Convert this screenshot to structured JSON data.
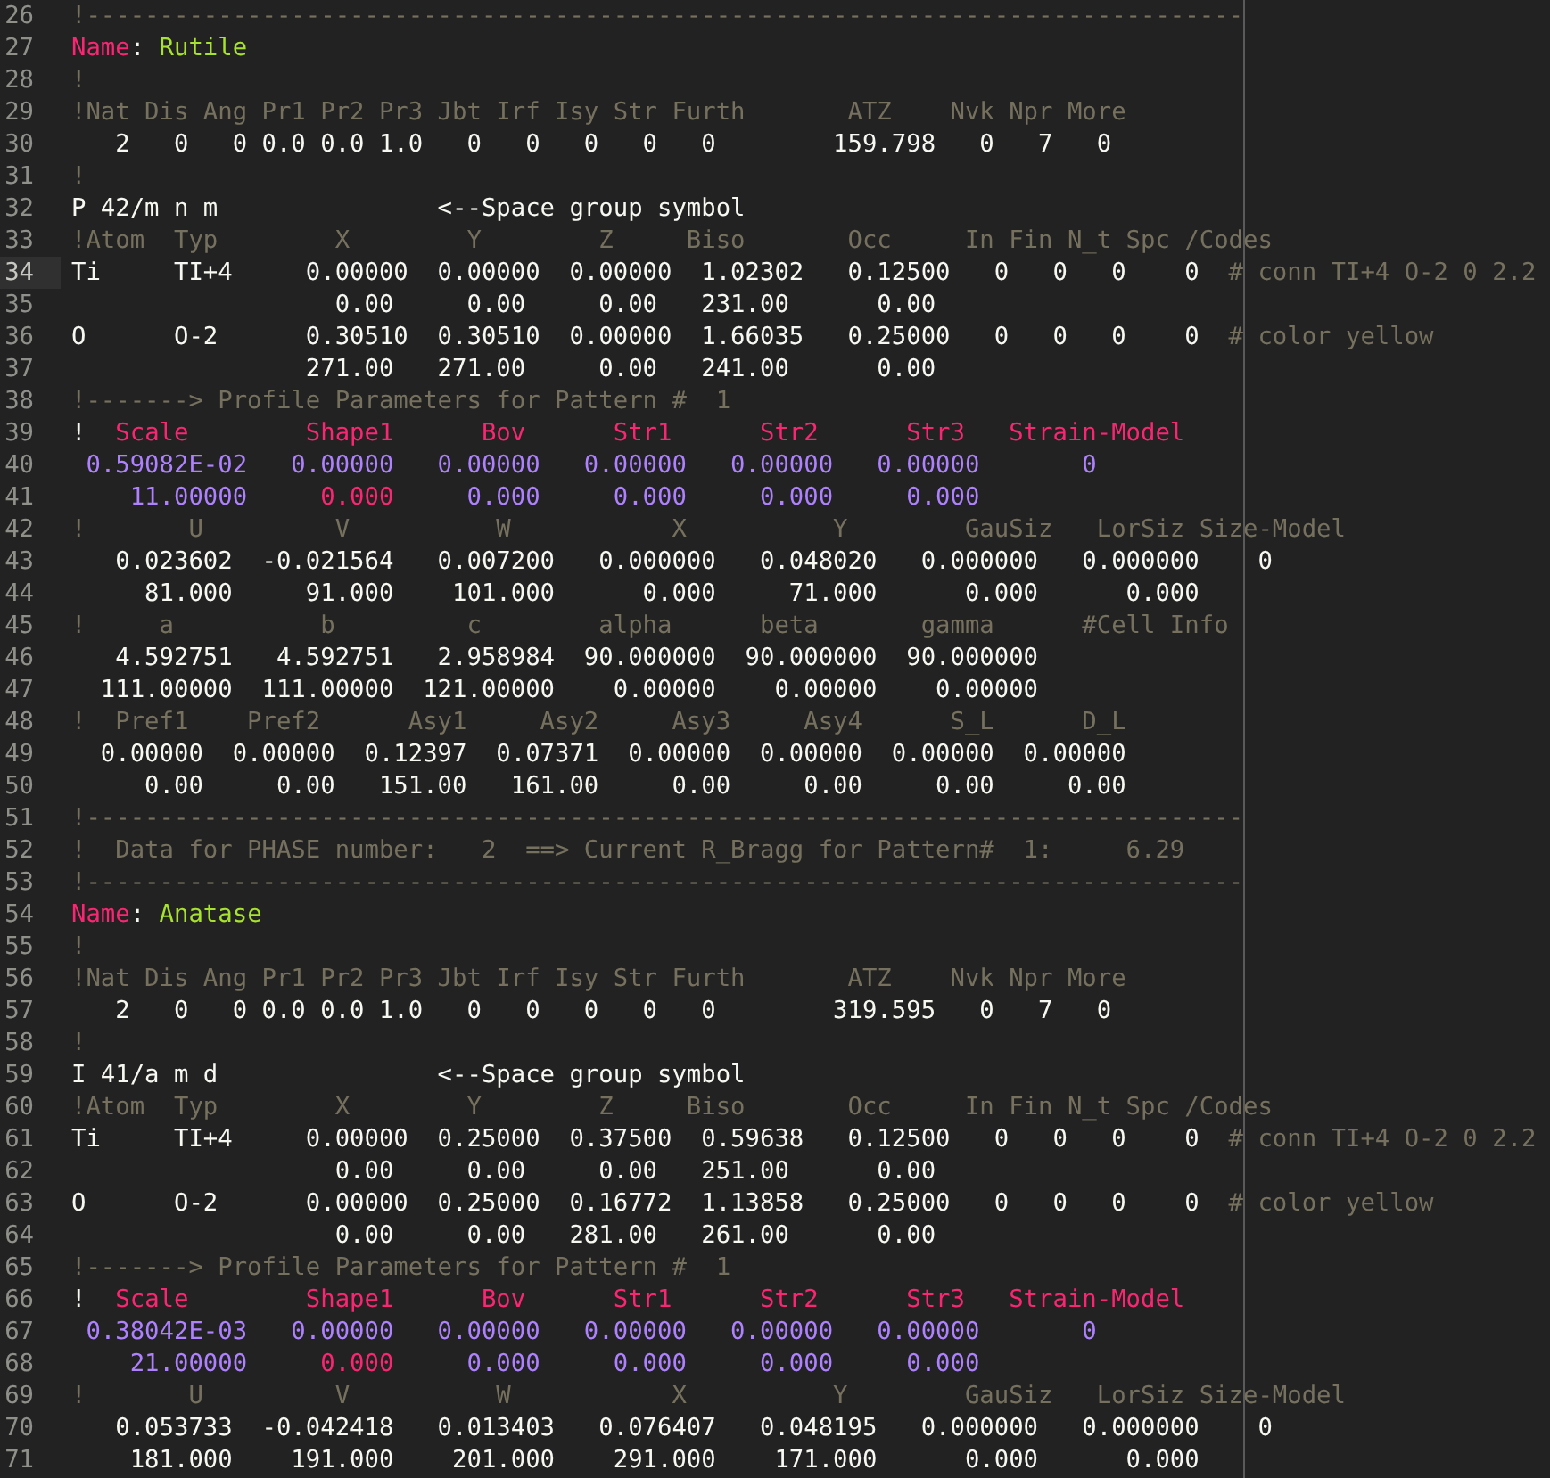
{
  "editor": {
    "lines": [
      {
        "number": "26",
        "current": false,
        "segments": [
          {
            "kind": "comment",
            "text": "!-------------------------------------------------------------------------------"
          }
        ]
      },
      {
        "number": "27",
        "current": false,
        "segments": [
          {
            "kind": "keyword",
            "text": "Name"
          },
          {
            "kind": "text",
            "text": ": "
          },
          {
            "kind": "string",
            "text": "Rutile"
          }
        ]
      },
      {
        "number": "28",
        "current": false,
        "segments": [
          {
            "kind": "comment",
            "text": "!"
          }
        ]
      },
      {
        "number": "29",
        "current": false,
        "segments": [
          {
            "kind": "comment",
            "text": "!Nat Dis Ang Pr1 Pr2 Pr3 Jbt Irf Isy Str Furth       ATZ    Nvk Npr More"
          }
        ]
      },
      {
        "number": "30",
        "current": false,
        "segments": [
          {
            "kind": "text",
            "text": "   2   0   0 0.0 0.0 1.0   0   0   0   0   0        159.798   0   7   0"
          }
        ]
      },
      {
        "number": "31",
        "current": false,
        "segments": [
          {
            "kind": "comment",
            "text": "!"
          }
        ]
      },
      {
        "number": "32",
        "current": false,
        "segments": [
          {
            "kind": "text",
            "text": "P 42/m n m               <--Space group symbol"
          }
        ]
      },
      {
        "number": "33",
        "current": false,
        "segments": [
          {
            "kind": "comment",
            "text": "!Atom  Typ        X        Y        Z     Biso       Occ     In Fin N_t Spc /Codes"
          }
        ]
      },
      {
        "number": "34",
        "current": true,
        "segments": [
          {
            "kind": "text",
            "text": "Ti     TI+4     0.00000  0.00000  0.00000  1.02302   0.12500   0   0   0    0  "
          },
          {
            "kind": "comment",
            "text": "# conn TI+4 O-2 0 2.2"
          }
        ]
      },
      {
        "number": "35",
        "current": false,
        "segments": [
          {
            "kind": "text",
            "text": "                  0.00     0.00     0.00   231.00      0.00"
          }
        ]
      },
      {
        "number": "36",
        "current": false,
        "segments": [
          {
            "kind": "text",
            "text": "O      O-2      0.30510  0.30510  0.00000  1.66035   0.25000   0   0   0    0  "
          },
          {
            "kind": "comment",
            "text": "# color yellow"
          }
        ]
      },
      {
        "number": "37",
        "current": false,
        "segments": [
          {
            "kind": "text",
            "text": "                271.00   271.00     0.00   241.00      0.00"
          }
        ]
      },
      {
        "number": "38",
        "current": false,
        "segments": [
          {
            "kind": "comment",
            "text": "!-------> Profile Parameters for Pattern #  1"
          }
        ]
      },
      {
        "number": "39",
        "current": false,
        "segments": [
          {
            "kind": "text",
            "text": "!"
          },
          {
            "kind": "keyword",
            "text": "  Scale        Shape1      Bov      Str1      Str2      Str3   Strain-Model"
          }
        ]
      },
      {
        "number": "40",
        "current": false,
        "segments": [
          {
            "kind": "number",
            "text": " 0.59082E-02   0.00000   0.00000   0.00000   0.00000   0.00000       0"
          }
        ]
      },
      {
        "number": "41",
        "current": false,
        "segments": [
          {
            "kind": "number",
            "text": "    11.00000"
          },
          {
            "kind": "keyword",
            "text": "     0.000"
          },
          {
            "kind": "number",
            "text": "     0.000     0.000     0.000     0.000"
          }
        ]
      },
      {
        "number": "42",
        "current": false,
        "segments": [
          {
            "kind": "comment",
            "text": "!       U         V          W           X          Y        GauSiz   LorSiz Size-Model"
          }
        ]
      },
      {
        "number": "43",
        "current": false,
        "segments": [
          {
            "kind": "text",
            "text": "   0.023602  -0.021564   0.007200   0.000000   0.048020   0.000000   0.000000    0"
          }
        ]
      },
      {
        "number": "44",
        "current": false,
        "segments": [
          {
            "kind": "text",
            "text": "     81.000     91.000    101.000      0.000     71.000      0.000      0.000"
          }
        ]
      },
      {
        "number": "45",
        "current": false,
        "segments": [
          {
            "kind": "comment",
            "text": "!     a          b         c        alpha      beta       gamma      #Cell Info"
          }
        ]
      },
      {
        "number": "46",
        "current": false,
        "segments": [
          {
            "kind": "text",
            "text": "   4.592751   4.592751   2.958984  90.000000  90.000000  90.000000"
          }
        ]
      },
      {
        "number": "47",
        "current": false,
        "segments": [
          {
            "kind": "text",
            "text": "  111.00000  111.00000  121.00000    0.00000    0.00000    0.00000"
          }
        ]
      },
      {
        "number": "48",
        "current": false,
        "segments": [
          {
            "kind": "comment",
            "text": "!  Pref1    Pref2      Asy1     Asy2     Asy3     Asy4      S_L      D_L"
          }
        ]
      },
      {
        "number": "49",
        "current": false,
        "segments": [
          {
            "kind": "text",
            "text": "  0.00000  0.00000  0.12397  0.07371  0.00000  0.00000  0.00000  0.00000"
          }
        ]
      },
      {
        "number": "50",
        "current": false,
        "segments": [
          {
            "kind": "text",
            "text": "     0.00     0.00   151.00   161.00     0.00     0.00     0.00     0.00"
          }
        ]
      },
      {
        "number": "51",
        "current": false,
        "segments": [
          {
            "kind": "comment",
            "text": "!-------------------------------------------------------------------------------"
          }
        ]
      },
      {
        "number": "52",
        "current": false,
        "segments": [
          {
            "kind": "comment",
            "text": "!  Data for PHASE number:   2  ==> Current R_Bragg for Pattern#  1:     6.29"
          }
        ]
      },
      {
        "number": "53",
        "current": false,
        "segments": [
          {
            "kind": "comment",
            "text": "!-------------------------------------------------------------------------------"
          }
        ]
      },
      {
        "number": "54",
        "current": false,
        "segments": [
          {
            "kind": "keyword",
            "text": "Name"
          },
          {
            "kind": "text",
            "text": ": "
          },
          {
            "kind": "string",
            "text": "Anatase"
          }
        ]
      },
      {
        "number": "55",
        "current": false,
        "segments": [
          {
            "kind": "comment",
            "text": "!"
          }
        ]
      },
      {
        "number": "56",
        "current": false,
        "segments": [
          {
            "kind": "comment",
            "text": "!Nat Dis Ang Pr1 Pr2 Pr3 Jbt Irf Isy Str Furth       ATZ    Nvk Npr More"
          }
        ]
      },
      {
        "number": "57",
        "current": false,
        "segments": [
          {
            "kind": "text",
            "text": "   2   0   0 0.0 0.0 1.0   0   0   0   0   0        319.595   0   7   0"
          }
        ]
      },
      {
        "number": "58",
        "current": false,
        "segments": [
          {
            "kind": "comment",
            "text": "!"
          }
        ]
      },
      {
        "number": "59",
        "current": false,
        "segments": [
          {
            "kind": "text",
            "text": "I 41/a m d               <--Space group symbol"
          }
        ]
      },
      {
        "number": "60",
        "current": false,
        "segments": [
          {
            "kind": "comment",
            "text": "!Atom  Typ        X        Y        Z     Biso       Occ     In Fin N_t Spc /Codes"
          }
        ]
      },
      {
        "number": "61",
        "current": false,
        "segments": [
          {
            "kind": "text",
            "text": "Ti     TI+4     0.00000  0.25000  0.37500  0.59638   0.12500   0   0   0    0  "
          },
          {
            "kind": "comment",
            "text": "# conn TI+4 O-2 0 2.2"
          }
        ]
      },
      {
        "number": "62",
        "current": false,
        "segments": [
          {
            "kind": "text",
            "text": "                  0.00     0.00     0.00   251.00      0.00"
          }
        ]
      },
      {
        "number": "63",
        "current": false,
        "segments": [
          {
            "kind": "text",
            "text": "O      O-2      0.00000  0.25000  0.16772  1.13858   0.25000   0   0   0    0  "
          },
          {
            "kind": "comment",
            "text": "# color yellow"
          }
        ]
      },
      {
        "number": "64",
        "current": false,
        "segments": [
          {
            "kind": "text",
            "text": "                  0.00     0.00   281.00   261.00      0.00"
          }
        ]
      },
      {
        "number": "65",
        "current": false,
        "segments": [
          {
            "kind": "comment",
            "text": "!-------> Profile Parameters for Pattern #  1"
          }
        ]
      },
      {
        "number": "66",
        "current": false,
        "segments": [
          {
            "kind": "text",
            "text": "!"
          },
          {
            "kind": "keyword",
            "text": "  Scale        Shape1      Bov      Str1      Str2      Str3   Strain-Model"
          }
        ]
      },
      {
        "number": "67",
        "current": false,
        "segments": [
          {
            "kind": "number",
            "text": " 0.38042E-03   0.00000   0.00000   0.00000   0.00000   0.00000       0"
          }
        ]
      },
      {
        "number": "68",
        "current": false,
        "segments": [
          {
            "kind": "number",
            "text": "    21.00000"
          },
          {
            "kind": "keyword",
            "text": "     0.000"
          },
          {
            "kind": "number",
            "text": "     0.000     0.000     0.000     0.000"
          }
        ]
      },
      {
        "number": "69",
        "current": false,
        "segments": [
          {
            "kind": "comment",
            "text": "!       U         V          W           X          Y        GauSiz   LorSiz Size-Model"
          }
        ]
      },
      {
        "number": "70",
        "current": false,
        "segments": [
          {
            "kind": "text",
            "text": "   0.053733  -0.042418   0.013403   0.076407   0.048195   0.000000   0.000000    0"
          }
        ]
      },
      {
        "number": "71",
        "current": false,
        "segments": [
          {
            "kind": "text",
            "text": "    181.000    191.000    201.000    291.000    171.000      0.000      0.000"
          }
        ]
      }
    ]
  }
}
